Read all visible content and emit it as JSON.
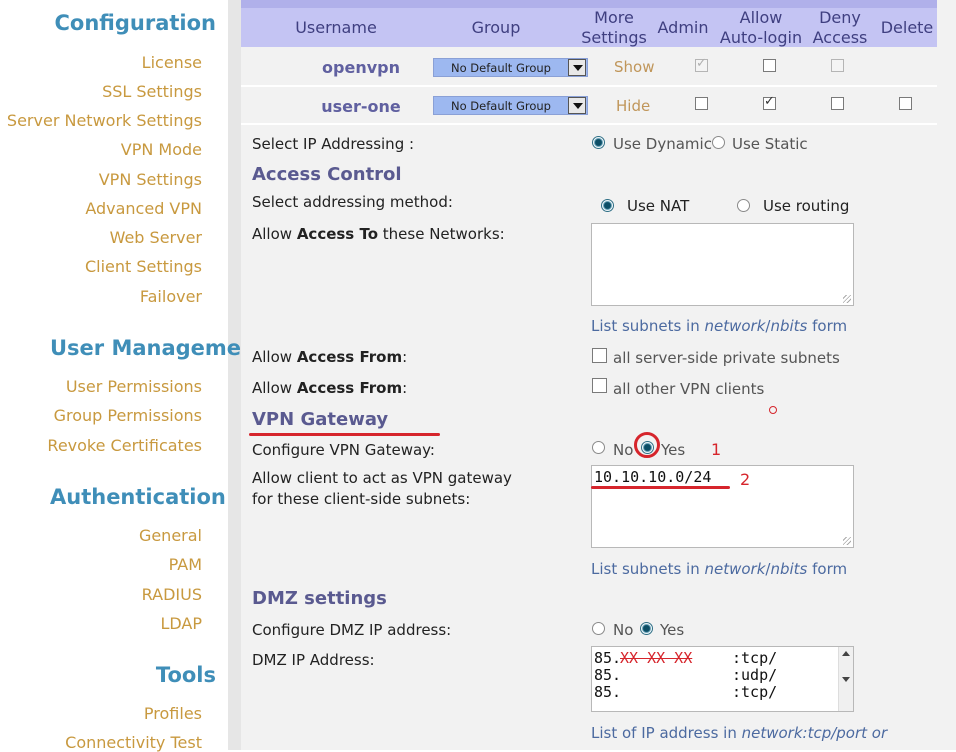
{
  "sidebar": {
    "configuration": {
      "heading": "Configuration",
      "items": [
        "License",
        "SSL Settings",
        "Server Network Settings",
        "VPN Mode",
        "VPN Settings",
        "Advanced VPN",
        "Web Server",
        "Client Settings",
        "Failover"
      ]
    },
    "user_management": {
      "heading": "User Management",
      "items": [
        "User Permissions",
        "Group Permissions",
        "Revoke Certificates"
      ]
    },
    "authentication": {
      "heading": "Authentication",
      "items": [
        "General",
        "PAM",
        "RADIUS",
        "LDAP"
      ]
    },
    "tools": {
      "heading": "Tools",
      "items": [
        "Profiles",
        "Connectivity Test"
      ]
    }
  },
  "table": {
    "headers": {
      "username": "Username",
      "group": "Group",
      "more1": "More",
      "more2": "Settings",
      "admin": "Admin",
      "allow1": "Allow",
      "allow2": "Auto-login",
      "deny1": "Deny",
      "deny2": "Access",
      "delete": "Delete"
    },
    "rows": [
      {
        "username": "openvpn",
        "group": "No Default Group",
        "more": "Show",
        "admin": true,
        "admin_disabled": true,
        "autologin": false,
        "deny": false
      },
      {
        "username": "user-one",
        "group": "No Default Group",
        "more": "Hide",
        "admin": false,
        "autologin": true,
        "deny": false,
        "delete": false
      }
    ]
  },
  "details": {
    "ip_addressing_label": "Select IP Addressing :",
    "use_dynamic": "Use Dynamic",
    "use_static": "Use Static",
    "access_control_title": "Access Control",
    "addressing_method_label": "Select addressing method:",
    "use_nat": "Use NAT",
    "use_routing": "Use routing",
    "allow_access_to_pre": "Allow ",
    "allow_access_to_bold": "Access To",
    "allow_access_to_post": " these Networks:",
    "subnets_hint_pre": "List subnets in ",
    "subnets_hint_italic1": "network",
    "subnets_hint_slash": "/",
    "subnets_hint_italic2": "nbits",
    "subnets_hint_post": " form",
    "allow_access_from_pre": "Allow ",
    "allow_access_from_bold": "Access From",
    "allow_access_from_post": ":",
    "server_side_subnets": "all server-side private subnets",
    "other_vpn_clients": "all other VPN clients",
    "vpn_gateway_title": "VPN Gateway",
    "configure_vpn_gateway_label": "Configure VPN Gateway:",
    "no": "No",
    "yes": "Yes",
    "gateway_subnets_label_1": "Allow client to act as VPN gateway",
    "gateway_subnets_label_2": "for these client-side subnets:",
    "gateway_subnets_value": "10.10.10.0/24",
    "annotation_1": "1",
    "annotation_2": "2",
    "dmz_title": "DMZ settings",
    "configure_dmz_label": "Configure DMZ IP address:",
    "dmz_ip_label": "DMZ IP Address:",
    "dmz_lines": [
      "85.",
      ":tcp/",
      "85.",
      ":udp/",
      "85.",
      ":tcp/"
    ],
    "dmz_masked": "XX XX XX",
    "dmz_hint_pre": "List of IP address in ",
    "dmz_hint_italic": "network:tcp/port or"
  },
  "colors": {
    "sidebar_heading": "#3f8eb8",
    "sidebar_item": "#c8993f",
    "table_header_bg": "#c4c4f3",
    "section_title": "#5a5a90",
    "annotation_red": "#d6252c"
  }
}
